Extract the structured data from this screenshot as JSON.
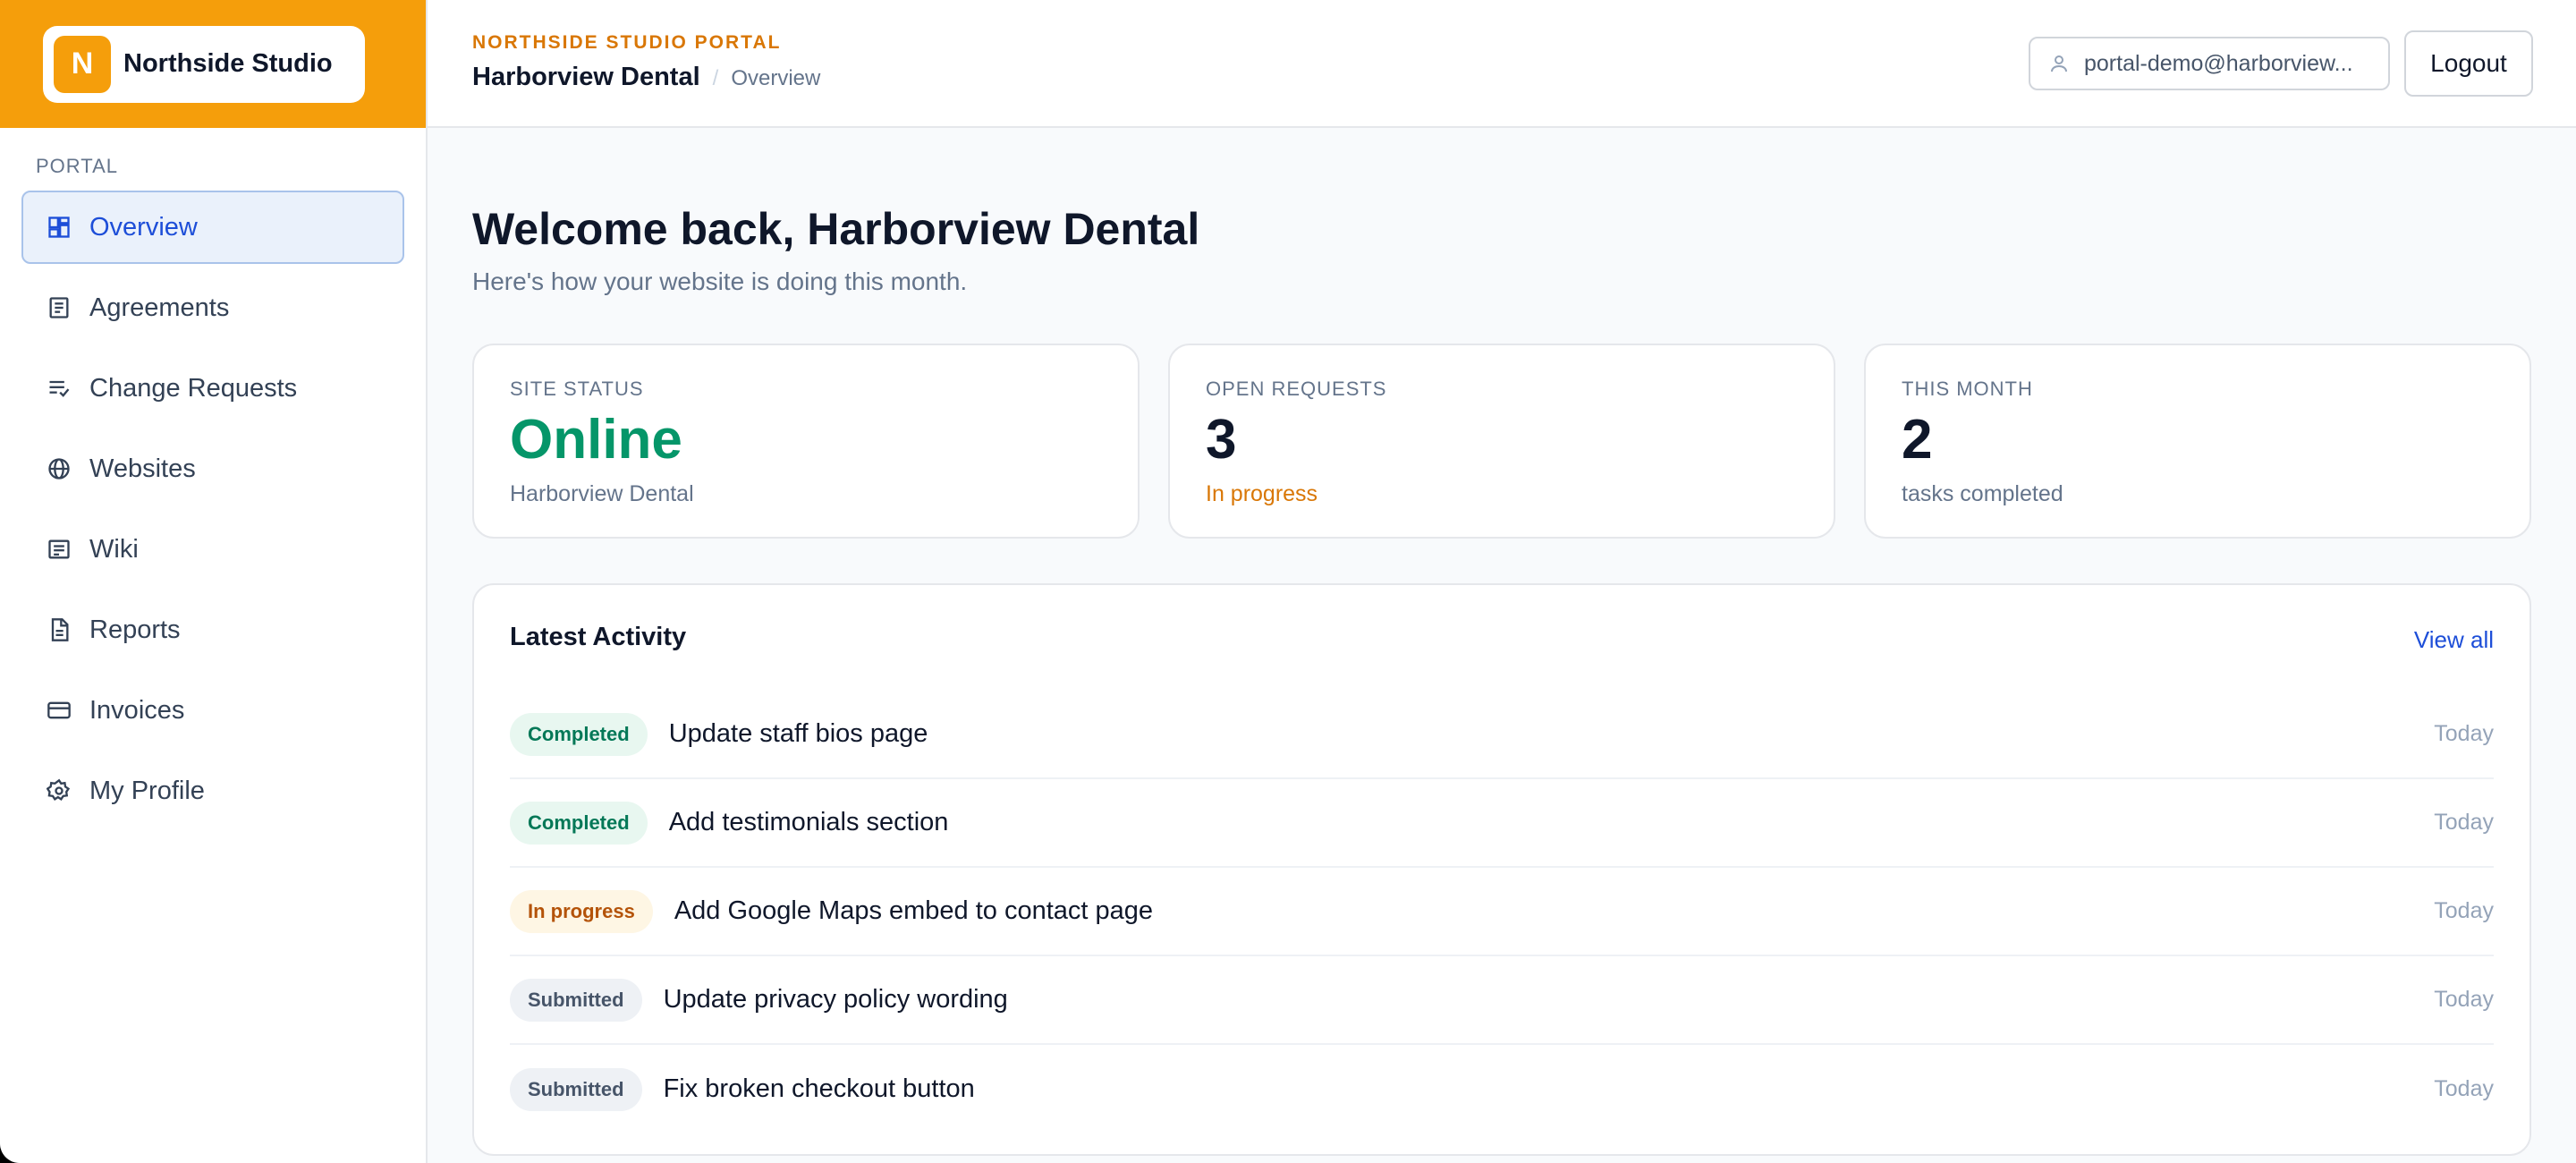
{
  "brand": {
    "badge_letter": "N",
    "name": "Northside Studio",
    "color": "#f59e0b"
  },
  "sidebar": {
    "section_label": "PORTAL",
    "items": [
      {
        "label": "Overview",
        "icon": "dashboard-icon",
        "active": true
      },
      {
        "label": "Agreements",
        "icon": "document-list-icon"
      },
      {
        "label": "Change Requests",
        "icon": "checklist-icon"
      },
      {
        "label": "Websites",
        "icon": "globe-icon"
      },
      {
        "label": "Wiki",
        "icon": "notes-icon"
      },
      {
        "label": "Reports",
        "icon": "report-icon"
      },
      {
        "label": "Invoices",
        "icon": "credit-card-icon"
      },
      {
        "label": "My Profile",
        "icon": "profile-gear-icon"
      }
    ]
  },
  "header": {
    "portal_label": "NORTHSIDE STUDIO PORTAL",
    "client": "Harborview Dental",
    "separator": "/",
    "page": "Overview",
    "user_email": "portal-demo@harborview...",
    "logout_label": "Logout"
  },
  "main": {
    "welcome": "Welcome back, Harborview Dental",
    "subtitle": "Here's how your website is doing this month.",
    "stats": [
      {
        "label": "SITE STATUS",
        "value": "Online",
        "note": "Harborview Dental",
        "value_color": "#059669",
        "note_color": "#64748b"
      },
      {
        "label": "OPEN REQUESTS",
        "value": "3",
        "note": "In progress",
        "value_color": "#0f172a",
        "note_color": "#d97706"
      },
      {
        "label": "THIS MONTH",
        "value": "2",
        "note": "tasks completed",
        "value_color": "#0f172a",
        "note_color": "#64748b"
      }
    ],
    "activity": {
      "title": "Latest Activity",
      "view_all": "View all",
      "rows": [
        {
          "status": "Completed",
          "kind": "completed",
          "title": "Update staff bios page",
          "date": "Today"
        },
        {
          "status": "Completed",
          "kind": "completed",
          "title": "Add testimonials section",
          "date": "Today"
        },
        {
          "status": "In progress",
          "kind": "progress",
          "title": "Add Google Maps embed to contact page",
          "date": "Today"
        },
        {
          "status": "Submitted",
          "kind": "submitted",
          "title": "Update privacy policy wording",
          "date": "Today"
        },
        {
          "status": "Submitted",
          "kind": "submitted",
          "title": "Fix broken checkout button",
          "date": "Today"
        }
      ]
    }
  }
}
